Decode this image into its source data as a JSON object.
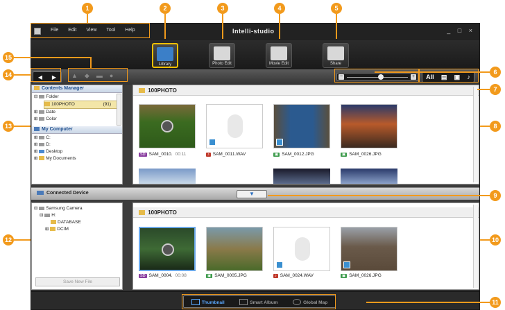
{
  "app": {
    "title": "Intelli-studio",
    "window_controls": "_ □ ×",
    "menu": [
      "File",
      "Edit",
      "View",
      "Tool",
      "Help"
    ]
  },
  "modes": [
    {
      "label": "Library",
      "icon": "library-icon",
      "active": true
    },
    {
      "label": "Photo Edit",
      "icon": "photo-edit-icon",
      "active": false
    },
    {
      "label": "Movie Edit",
      "icon": "movie-edit-icon",
      "active": false
    },
    {
      "label": "Share",
      "icon": "share-globe-icon",
      "active": false
    }
  ],
  "toolbar": {
    "nav_back": "◀",
    "nav_forward": "▶",
    "zoom_minus": "−",
    "zoom_plus": "+",
    "zoom_level": 0.55,
    "filters": {
      "all": "All",
      "video": "▤",
      "photo": "▣",
      "audio": "♪"
    }
  },
  "contents_manager": {
    "title": "Contents Manager",
    "items": [
      {
        "label": "Folder"
      },
      {
        "label": "100PHOTO",
        "count": "(91)"
      },
      {
        "label": "Date"
      },
      {
        "label": "Color"
      }
    ]
  },
  "my_computer": {
    "title": "My Computer",
    "items": [
      "C:",
      "D:",
      "Desktop",
      "My Documents"
    ]
  },
  "library_panel": {
    "folder": "100PHOTO",
    "files": [
      {
        "name": "SAM_0010.",
        "badge": "SD",
        "time": "00:11",
        "kind": "video"
      },
      {
        "name": "SAM_0011.WAV",
        "badge": "♪",
        "kind": "audio"
      },
      {
        "name": "SAM_0012.JPG",
        "badge": "▣",
        "kind": "image"
      },
      {
        "name": "SAM_0026.JPG",
        "badge": "▣",
        "kind": "image"
      }
    ]
  },
  "device_bar": {
    "label": "Connected Device",
    "toggle": "▼"
  },
  "device_tree": {
    "items": [
      "Samsung Camera",
      "H:",
      "DATABASE",
      "DCIM"
    ],
    "save_button": "Save New File"
  },
  "device_panel": {
    "folder": "100PHOTO",
    "files": [
      {
        "name": "SAM_0004.",
        "badge": "SD",
        "time": "00:08",
        "kind": "video"
      },
      {
        "name": "SAM_0005.JPG",
        "badge": "▣",
        "kind": "image"
      },
      {
        "name": "SAM_0024.WAV",
        "badge": "♪",
        "kind": "audio"
      },
      {
        "name": "SAM_0026.JPG",
        "badge": "▣",
        "kind": "image"
      }
    ]
  },
  "bottom_tabs": [
    {
      "label": "Thumbnail",
      "active": true
    },
    {
      "label": "Smart Album",
      "active": false
    },
    {
      "label": "Global Map",
      "active": false
    }
  ],
  "callouts": [
    "1",
    "2",
    "3",
    "4",
    "5",
    "6",
    "7",
    "8",
    "9",
    "10",
    "11",
    "12",
    "13",
    "14",
    "15"
  ],
  "colors": {
    "callout": "#f29a1c",
    "active_mode_border": "#f2c000",
    "accent": "#2a6fc0"
  }
}
